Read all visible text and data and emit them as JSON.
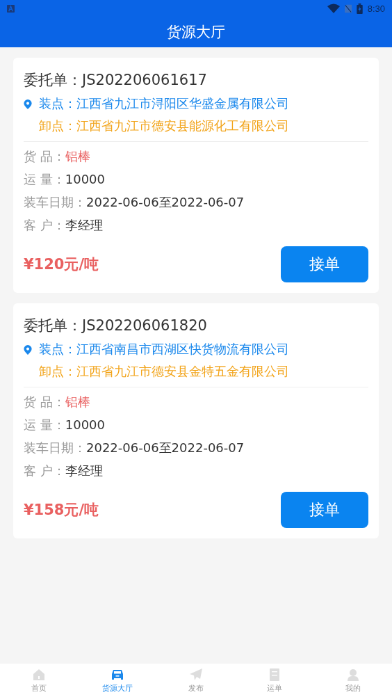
{
  "status_bar": {
    "time": "8:30"
  },
  "app_bar": {
    "title": "货源大厅"
  },
  "orders": [
    {
      "title": "委托单：JS202206061617",
      "load": "装点：江西省九江市浔阳区华盛金属有限公司",
      "unload": "卸点：江西省九江市德安县能源化工有限公司",
      "details": [
        {
          "label": "货 品：",
          "value": "铝棒",
          "highlighted": true
        },
        {
          "label": "运 量：",
          "value": "10000",
          "highlighted": false
        },
        {
          "label": "装车日期：",
          "value": "2022-06-06至2022-06-07",
          "highlighted": false
        },
        {
          "label": "客 户：",
          "value": "李经理",
          "highlighted": false
        }
      ],
      "price": "¥120元/吨",
      "action": "接单"
    },
    {
      "title": "委托单：JS202206061820",
      "load": "装点：江西省南昌市西湖区快货物流有限公司",
      "unload": "卸点：江西省九江市德安县金特五金有限公司",
      "details": [
        {
          "label": "货 品：",
          "value": "铝棒",
          "highlighted": true
        },
        {
          "label": "运 量：",
          "value": "10000",
          "highlighted": false
        },
        {
          "label": "装车日期：",
          "value": "2022-06-06至2022-06-07",
          "highlighted": false
        },
        {
          "label": "客 户：",
          "value": "李经理",
          "highlighted": false
        }
      ],
      "price": "¥158元/吨",
      "action": "接单"
    }
  ],
  "tabs": [
    {
      "label": "首页",
      "kind": "home",
      "selected": false
    },
    {
      "label": "货源大厅",
      "kind": "truck",
      "selected": true
    },
    {
      "label": "发布",
      "kind": "send",
      "selected": false
    },
    {
      "label": "运单",
      "kind": "list",
      "selected": false
    },
    {
      "label": "我的",
      "kind": "user",
      "selected": false
    }
  ]
}
